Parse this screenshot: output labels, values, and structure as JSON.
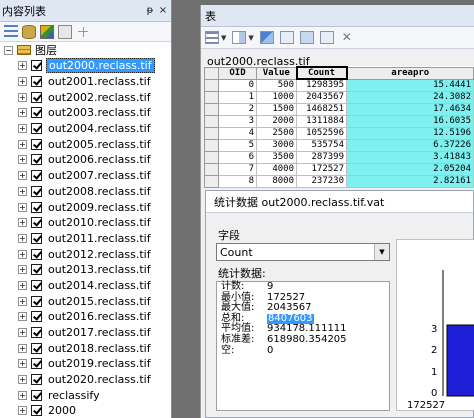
{
  "toc": {
    "title": "内容列表",
    "pin": "ᵽ",
    "close": "×",
    "group": "图层",
    "layers": [
      "out2000.reclass.tif",
      "out2001.reclass.tif",
      "out2002.reclass.tif",
      "out2003.reclass.tif",
      "out2004.reclass.tif",
      "out2005.reclass.tif",
      "out2006.reclass.tif",
      "out2007.reclass.tif",
      "out2008.reclass.tif",
      "out2009.reclass.tif",
      "out2010.reclass.tif",
      "out2011.reclass.tif",
      "out2012.reclass.tif",
      "out2013.reclass.tif",
      "out2014.reclass.tif",
      "out2015.reclass.tif",
      "out2016.reclass.tif",
      "out2017.reclass.tif",
      "out2018.reclass.tif",
      "out2019.reclass.tif",
      "out2020.reclass.tif",
      "reclassify",
      "2000"
    ],
    "selected_index": 0
  },
  "table": {
    "title": "表",
    "tab_name": "out2000.reclass.tif",
    "columns": [
      "OID",
      "Value",
      "Count",
      "areapro"
    ],
    "rows": [
      [
        "0",
        "500",
        "1298395",
        "15.4441"
      ],
      [
        "1",
        "1000",
        "2043567",
        "24.3082"
      ],
      [
        "2",
        "1500",
        "1468251",
        "17.4634"
      ],
      [
        "3",
        "2000",
        "1311884",
        "16.6035"
      ],
      [
        "4",
        "2500",
        "1052596",
        "12.5196"
      ],
      [
        "5",
        "3000",
        "535754",
        "6.37226"
      ],
      [
        "6",
        "3500",
        "287399",
        "3.41843"
      ],
      [
        "7",
        "4000",
        "172527",
        "2.05204"
      ],
      [
        "8",
        "8000",
        "237230",
        "2.82161"
      ]
    ]
  },
  "stats": {
    "title": "统计数据 out2000.reclass.tif.vat",
    "field_label": "字段",
    "field_value": "Count",
    "stats_label": "统计数据:",
    "items": [
      {
        "key": "计数:",
        "value": "9"
      },
      {
        "key": "最小值:",
        "value": "172527"
      },
      {
        "key": "最大值:",
        "value": "2043567"
      },
      {
        "key": "总和:",
        "value": "8407603"
      },
      {
        "key": "平均值:",
        "value": "934178.111111"
      },
      {
        "key": "标准差:",
        "value": "618980.354205"
      },
      {
        "key": "空:",
        "value": "0"
      }
    ],
    "highlighted_index": 3,
    "histogram": {
      "y_ticks": [
        "3",
        "2",
        "1",
        "0"
      ],
      "x_label": "172527",
      "bar_color": "#1f1fd8"
    }
  }
}
